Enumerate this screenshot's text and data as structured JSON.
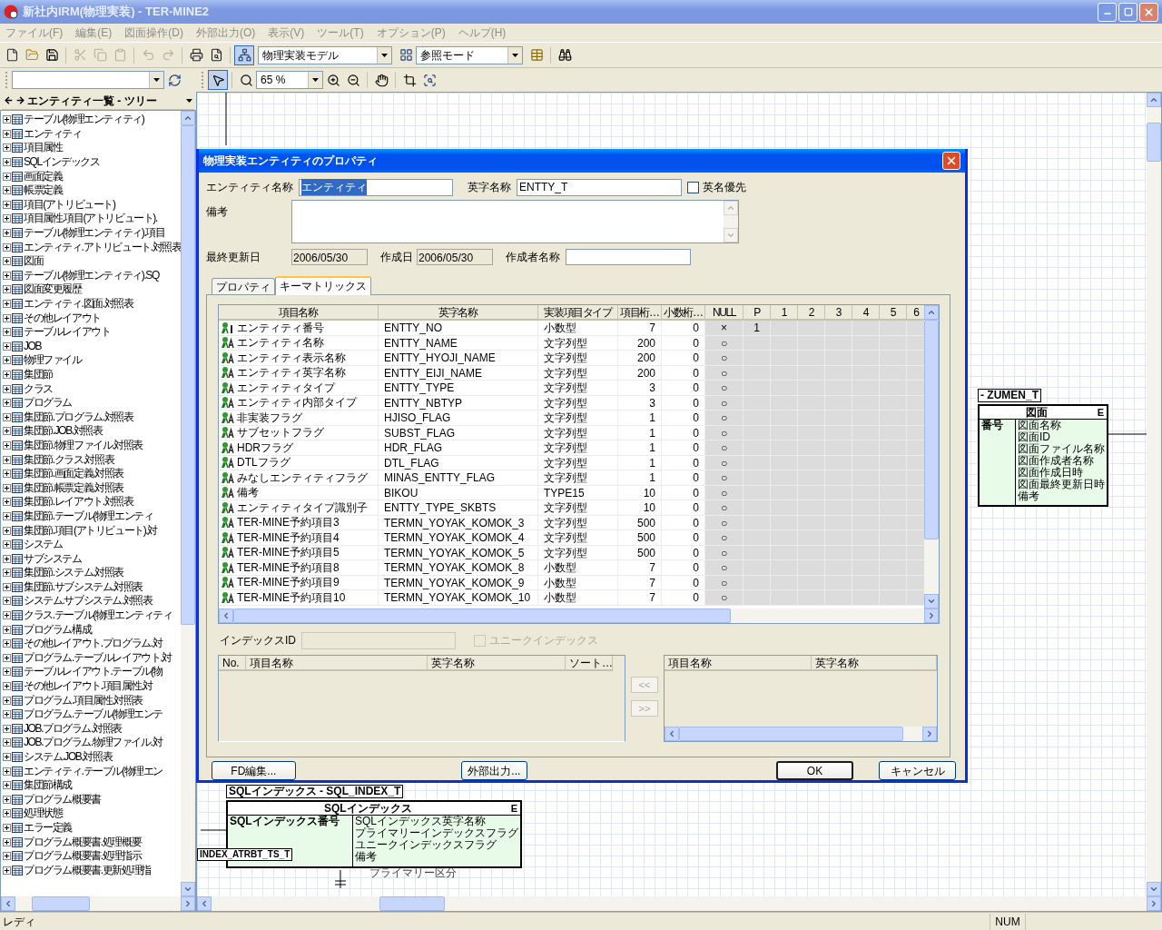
{
  "window": {
    "title": "新社内IRM(物理実装) - TER-MINE2"
  },
  "menu": [
    "ファイル(F)",
    "編集(E)",
    "図面操作(D)",
    "外部出力(O)",
    "表示(V)",
    "ツール(T)",
    "オプション(P)",
    "ヘルプ(H)"
  ],
  "toolbar": {
    "layout_toggle_pressed": true,
    "model_select": "物理実装モデル",
    "mode_select": "参照モード"
  },
  "left_panel": {
    "tree_header": "エンティティ一覧 - ツリー",
    "tree_items": [
      {
        "label": "テーブル(物理エンティティ)",
        "expanded": false
      },
      {
        "label": "エンティティ",
        "expanded": false
      },
      {
        "label": "項目属性",
        "expanded": false
      },
      {
        "label": "SQLインデックス",
        "expanded": false
      },
      {
        "label": "画面定義",
        "expanded": false
      },
      {
        "label": "帳票定義",
        "expanded": false
      },
      {
        "label": "項目(アトリビュート)",
        "expanded": false
      },
      {
        "label": "項目属性.項目(アトリビュート).",
        "expanded": false
      },
      {
        "label": "テーブル(物理エンティティ).項目",
        "expanded": false
      },
      {
        "label": "エンティティ.アトリビュート.対照表",
        "expanded": false
      },
      {
        "label": "図面",
        "expanded": false
      },
      {
        "label": "テーブル(物理エンティティ).SQ",
        "expanded": false
      },
      {
        "label": "図面変更履歴",
        "expanded": false
      },
      {
        "label": "エンティティ.図面.対照表",
        "expanded": false
      },
      {
        "label": "その他レイアウト",
        "expanded": false
      },
      {
        "label": "テーブルレイアウト",
        "expanded": false
      },
      {
        "label": "JOB",
        "expanded": false
      },
      {
        "label": "物理ファイル",
        "expanded": false
      },
      {
        "label": "集団節",
        "expanded": false
      },
      {
        "label": "クラス",
        "expanded": false
      },
      {
        "label": "プログラム",
        "expanded": false
      },
      {
        "label": "集団節.プログラム.対照表",
        "expanded": false
      },
      {
        "label": "集団節.JOB.対照表",
        "expanded": false
      },
      {
        "label": "集団節.物理ファイル.対照表",
        "expanded": false
      },
      {
        "label": "集団節.クラス.対照表",
        "expanded": false
      },
      {
        "label": "集団節.画面定義.対照表",
        "expanded": false
      },
      {
        "label": "集団節.帳票定義.対照表",
        "expanded": false
      },
      {
        "label": "集団節.レイアウト.対照表",
        "expanded": false
      },
      {
        "label": "集団節.テーブル(物理エンティ",
        "expanded": false
      },
      {
        "label": "集団節.項目(アトリビュート).対",
        "expanded": false
      },
      {
        "label": "システム",
        "expanded": false
      },
      {
        "label": "サブシステム",
        "expanded": false
      },
      {
        "label": "集団節.システム.対照表",
        "expanded": false
      },
      {
        "label": "集団節.サブシステム.対照表",
        "expanded": false
      },
      {
        "label": "システム.サブシステム.対照表",
        "expanded": false
      },
      {
        "label": "クラス.テーブル(物理エンティティ",
        "expanded": false
      },
      {
        "label": "プログラム構成",
        "expanded": false
      },
      {
        "label": "その他レイアウト.プログラム.対",
        "expanded": false
      },
      {
        "label": "プログラム.テーブルレイアウト.対",
        "expanded": false
      },
      {
        "label": "テーブルレイアウト.テーブル(物",
        "expanded": false
      },
      {
        "label": "その他レイアウト.項目属性.対",
        "expanded": false
      },
      {
        "label": "プログラム.項目属性.対照表",
        "expanded": false
      },
      {
        "label": "プログラム.テーブル(物理エンテ",
        "expanded": false
      },
      {
        "label": "JOB.プログラム.対照表",
        "expanded": false
      },
      {
        "label": "JOB.プログラム.物理ファイル.対",
        "expanded": false
      },
      {
        "label": "システム.JOB.対照表",
        "expanded": false
      },
      {
        "label": "エンティティ.テーブル(物理エン",
        "expanded": false
      },
      {
        "label": "集団節構成",
        "expanded": false
      },
      {
        "label": "プログラム概要書",
        "expanded": false
      },
      {
        "label": "処理状態",
        "expanded": false
      },
      {
        "label": "エラー定義",
        "expanded": false
      },
      {
        "label": "プログラム概要書.処理概要",
        "expanded": false
      },
      {
        "label": "プログラム概要書.処理指示",
        "expanded": false
      },
      {
        "label": "プログラム概要書.更新処理指",
        "expanded": false
      }
    ]
  },
  "canvas_toolbar": {
    "select_tool_selected": true,
    "zoom": "65 %"
  },
  "canvas": {
    "entities": [
      {
        "label": "SQLインデックス - SQL_INDEX_T",
        "title": "SQLインデックス",
        "type_mark": "E",
        "keys": [
          "SQLインデックス番号"
        ],
        "attributes": [
          "SQLインデックス英字名称",
          "プライマリーインデックスフラグ",
          "ユニークインデックスフラグ",
          "備考"
        ]
      },
      {
        "label": "- ZUMEN_T",
        "title": "図面",
        "type_mark": "E",
        "keys": [
          "番号"
        ],
        "attributes": [
          "図面名称",
          "図面ID",
          "図面ファイル名称",
          "図面作成者名称",
          "図面作成日時",
          "図面最終更新日時",
          "備考"
        ]
      }
    ],
    "notes": [
      "INDEX_ATRBT_TS_T",
      "プライマリー区分"
    ]
  },
  "dialog": {
    "title": "物理実装エンティティのプロパティ",
    "entity_name_label": "エンティティ名称",
    "entity_name": "エンティティ",
    "english_name_label": "英字名称",
    "english_name": "ENTTY_T",
    "english_priority": {
      "label": "英名優先",
      "checked": false
    },
    "remarks_label": "備考",
    "updated_label": "最終更新日",
    "updated": "2006/05/30",
    "created_label": "作成日",
    "created": "2006/05/30",
    "author_label": "作成者名称",
    "tabs": [
      {
        "label": "プロパティ",
        "selected": false
      },
      {
        "label": "キーマトリックス",
        "selected": true
      }
    ],
    "matrix": {
      "columns": [
        "項目名称",
        "英字名称",
        "実装項目タイプ",
        "項目桁…",
        "小数桁…",
        "NULL",
        "P",
        "1",
        "2",
        "3",
        "4",
        "5",
        "6"
      ],
      "rows": [
        {
          "kind": "key",
          "name": "エンティティ番号",
          "english": "ENTTY_NO",
          "type": "小数型",
          "length": "7",
          "scale": "0",
          "null": "×",
          "p": "1"
        },
        {
          "kind": "attribute",
          "name": "エンティティ名称",
          "english": "ENTTY_NAME",
          "type": "文字列型",
          "length": "200",
          "scale": "0",
          "null": "○"
        },
        {
          "kind": "attribute",
          "name": "エンティティ表示名称",
          "english": "ENTTY_HYOJI_NAME",
          "type": "文字列型",
          "length": "200",
          "scale": "0",
          "null": "○"
        },
        {
          "kind": "attribute",
          "name": "エンティティ英字名称",
          "english": "ENTTY_EIJI_NAME",
          "type": "文字列型",
          "length": "200",
          "scale": "0",
          "null": "○"
        },
        {
          "kind": "attribute",
          "name": "エンティティタイプ",
          "english": "ENTTY_TYPE",
          "type": "文字列型",
          "length": "3",
          "scale": "0",
          "null": "○"
        },
        {
          "kind": "attribute",
          "name": "エンティティ内部タイプ",
          "english": "ENTTY_NBTYP",
          "type": "文字列型",
          "length": "3",
          "scale": "0",
          "null": "○"
        },
        {
          "kind": "attribute",
          "name": "非実装フラグ",
          "english": "HJISO_FLAG",
          "type": "文字列型",
          "length": "1",
          "scale": "0",
          "null": "○"
        },
        {
          "kind": "attribute",
          "name": "サブセットフラグ",
          "english": "SUBST_FLAG",
          "type": "文字列型",
          "length": "1",
          "scale": "0",
          "null": "○"
        },
        {
          "kind": "attribute",
          "name": "HDRフラグ",
          "english": "HDR_FLAG",
          "type": "文字列型",
          "length": "1",
          "scale": "0",
          "null": "○"
        },
        {
          "kind": "attribute",
          "name": "DTLフラグ",
          "english": "DTL_FLAG",
          "type": "文字列型",
          "length": "1",
          "scale": "0",
          "null": "○"
        },
        {
          "kind": "attribute",
          "name": "みなしエンティティフラグ",
          "english": "MINAS_ENTTY_FLAG",
          "type": "文字列型",
          "length": "1",
          "scale": "0",
          "null": "○"
        },
        {
          "kind": "attribute",
          "name": "備考",
          "english": "BIKOU",
          "type": "TYPE15",
          "length": "10",
          "scale": "0",
          "null": "○"
        },
        {
          "kind": "attribute",
          "name": "エンティティタイプ識別子",
          "english": "ENTTY_TYPE_SKBTS",
          "type": "文字列型",
          "length": "10",
          "scale": "0",
          "null": "○"
        },
        {
          "kind": "attribute",
          "name": "TER-MINE予約項目3",
          "english": "TERMN_YOYAK_KOMOK_3",
          "type": "文字列型",
          "length": "500",
          "scale": "0",
          "null": "○"
        },
        {
          "kind": "attribute",
          "name": "TER-MINE予約項目4",
          "english": "TERMN_YOYAK_KOMOK_4",
          "type": "文字列型",
          "length": "500",
          "scale": "0",
          "null": "○"
        },
        {
          "kind": "attribute",
          "name": "TER-MINE予約項目5",
          "english": "TERMN_YOYAK_KOMOK_5",
          "type": "文字列型",
          "length": "500",
          "scale": "0",
          "null": "○"
        },
        {
          "kind": "attribute",
          "name": "TER-MINE予約項目8",
          "english": "TERMN_YOYAK_KOMOK_8",
          "type": "小数型",
          "length": "7",
          "scale": "0",
          "null": "○"
        },
        {
          "kind": "attribute",
          "name": "TER-MINE予約項目9",
          "english": "TERMN_YOYAK_KOMOK_9",
          "type": "小数型",
          "length": "7",
          "scale": "0",
          "null": "○"
        },
        {
          "kind": "attribute",
          "name": "TER-MINE予約項目10",
          "english": "TERMN_YOYAK_KOMOK_10",
          "type": "小数型",
          "length": "7",
          "scale": "0",
          "null": "○"
        }
      ]
    },
    "index_id_label": "インデックスID",
    "unique_index": {
      "label": "ユニークインデックス",
      "checked": false,
      "disabled": true
    },
    "index_columns": [
      "No.",
      "項目名称",
      "英字名称",
      "ソート…"
    ],
    "item_columns": [
      "項目名称",
      "英字名称"
    ],
    "move_buttons": [
      {
        "label": "<<",
        "disabled": true
      },
      {
        "label": ">>",
        "disabled": true
      }
    ],
    "buttons": [
      {
        "kind": "left",
        "label": "FD編集..."
      },
      {
        "kind": "center",
        "label": "外部出力..."
      },
      {
        "kind": "default",
        "label": "OK"
      },
      {
        "kind": "right",
        "label": "キャンセル"
      }
    ]
  },
  "status_bar": {
    "message": "レディ",
    "num_lock": "NUM"
  }
}
